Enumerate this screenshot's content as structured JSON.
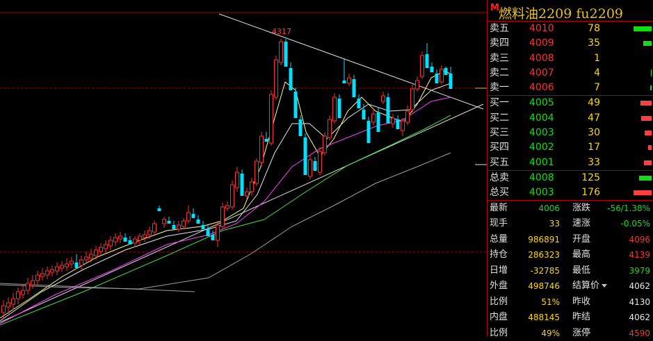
{
  "header": {
    "marker": "M",
    "title": "燃料油2209  fu2209"
  },
  "chart": {
    "high_label": "4317"
  },
  "asks": [
    {
      "label": "卖五",
      "price": "4010",
      "volume": "78",
      "share": 1.0
    },
    {
      "label": "卖四",
      "price": "4009",
      "volume": "35",
      "share": 0.45
    },
    {
      "label": "卖三",
      "price": "4008",
      "volume": "1",
      "share": 0.0
    },
    {
      "label": "卖二",
      "price": "4007",
      "volume": "4",
      "share": 0.05
    },
    {
      "label": "卖一",
      "price": "4006",
      "volume": "7",
      "share": 0.09
    }
  ],
  "bids": [
    {
      "label": "买一",
      "price": "4005",
      "volume": "49",
      "share": 0.6
    },
    {
      "label": "买二",
      "price": "4004",
      "volume": "47",
      "share": 0.58
    },
    {
      "label": "买三",
      "price": "4003",
      "volume": "30",
      "share": 0.37
    },
    {
      "label": "买四",
      "price": "4002",
      "volume": "17",
      "share": 0.21
    },
    {
      "label": "买五",
      "price": "4001",
      "volume": "33",
      "share": 0.41
    }
  ],
  "totals": [
    {
      "label": "总卖",
      "price": "4008",
      "volume": "125",
      "share": 0.7,
      "color": "#10e010"
    },
    {
      "label": "总买",
      "price": "4003",
      "volume": "176",
      "share": 1.0,
      "color": "#ff4040"
    }
  ],
  "stats": [
    {
      "l1": "最新",
      "v1": "4006",
      "c1": "green",
      "l2": "涨跌",
      "v2": "-56/1.38%",
      "c2": "green"
    },
    {
      "l1": "现手",
      "v1": "33",
      "c1": "yellow",
      "l2": "速涨",
      "v2": "-0.05%",
      "c2": "green"
    },
    {
      "l1": "总量",
      "v1": "986891",
      "c1": "yellow",
      "l2": "开盘",
      "v2": "4096",
      "c2": "red"
    },
    {
      "l1": "持仓",
      "v1": "286323",
      "c1": "yellow",
      "l2": "最高",
      "v2": "4139",
      "c2": "red"
    },
    {
      "l1": "日增",
      "v1": "-32785",
      "c1": "yellow",
      "l2": "最低",
      "v2": "3979",
      "c2": "green"
    },
    {
      "l1": "外盘",
      "v1": "498746",
      "c1": "yellow",
      "l2": "结算价",
      "v2": "4062",
      "c2": "white"
    },
    {
      "l1": "比例",
      "v1": "51%",
      "c1": "yellow",
      "l2": "昨收",
      "v2": "4130",
      "c2": "white"
    },
    {
      "l1": "内盘",
      "v1": "488145",
      "c1": "yellow",
      "l2": "昨结",
      "v2": "4062",
      "c2": "white"
    },
    {
      "l1": "比例",
      "v1": "49%",
      "c1": "yellow",
      "l2": "涨停",
      "v2": "4590",
      "c2": "red"
    }
  ],
  "colors": {
    "up": "#ff3030",
    "down": "#00e0ff",
    "ask_bar": "#10e010",
    "bid_bar": "#ff4040"
  }
}
